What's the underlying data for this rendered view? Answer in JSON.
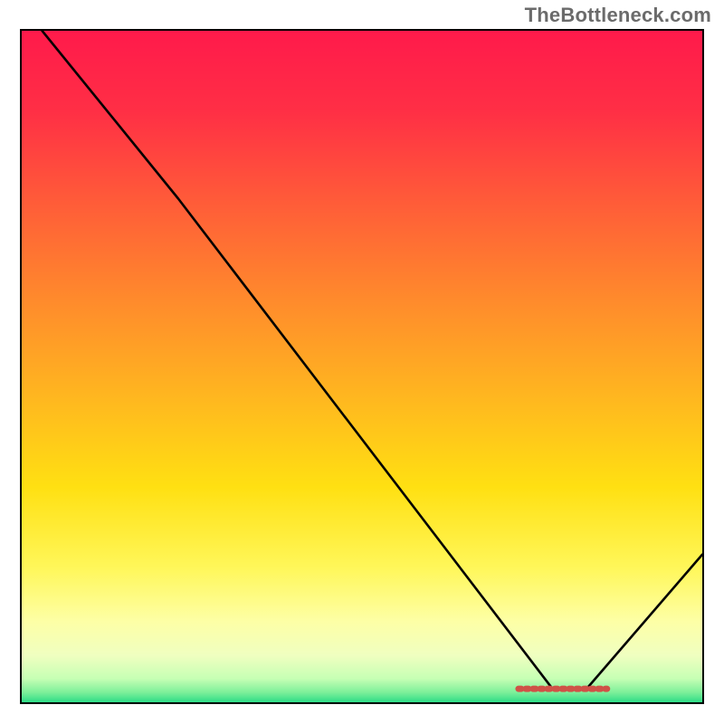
{
  "watermark": "TheBottleneck.com",
  "chart_data": {
    "type": "line",
    "title": "",
    "xlabel": "",
    "ylabel": "",
    "xlim": [
      0,
      100
    ],
    "ylim": [
      0,
      100
    ],
    "grid": false,
    "legend": false,
    "data_line": {
      "name": "curve",
      "x": [
        3,
        23,
        78,
        83,
        100
      ],
      "y": [
        100,
        75,
        2,
        2,
        22
      ]
    },
    "marker_segment": {
      "name": "minimum-marker",
      "x_start": 73,
      "x_end": 86,
      "y": 2,
      "color": "#cf5247"
    },
    "gradient_stops": [
      {
        "offset": 0.0,
        "color": "#ff1a4b"
      },
      {
        "offset": 0.12,
        "color": "#ff2f45"
      },
      {
        "offset": 0.25,
        "color": "#ff5a39"
      },
      {
        "offset": 0.4,
        "color": "#ff8a2c"
      },
      {
        "offset": 0.55,
        "color": "#ffb81f"
      },
      {
        "offset": 0.68,
        "color": "#ffe012"
      },
      {
        "offset": 0.8,
        "color": "#fff75a"
      },
      {
        "offset": 0.88,
        "color": "#fdffa6"
      },
      {
        "offset": 0.93,
        "color": "#f0ffc0"
      },
      {
        "offset": 0.965,
        "color": "#c6ffb4"
      },
      {
        "offset": 0.985,
        "color": "#7ef09a"
      },
      {
        "offset": 1.0,
        "color": "#2edc87"
      }
    ]
  }
}
